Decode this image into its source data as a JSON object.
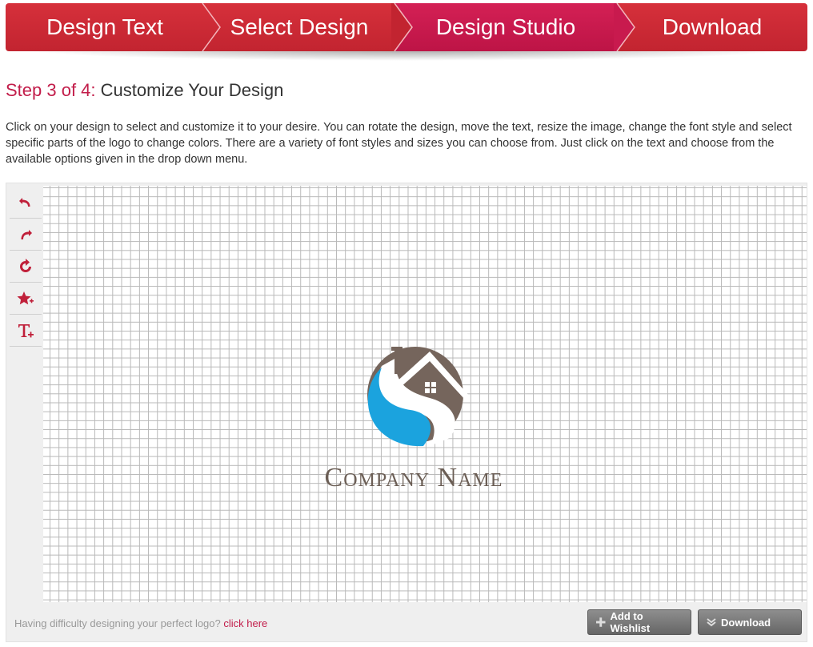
{
  "steps": [
    {
      "label": "Design Text"
    },
    {
      "label": "Select Design"
    },
    {
      "label": "Design Studio"
    },
    {
      "label": "Download"
    }
  ],
  "heading": {
    "step_prefix": "Step 3 of 4:",
    "title": "Customize Your Design"
  },
  "description": "Click on your design to select and customize it to your desire. You can rotate the design, move the text, resize the image, change the font style and select specific parts of the logo to change colors. There are a variety of font styles and sizes you can choose from. Just click on the text and choose from the available options given in the drop down menu.",
  "toolbar": {
    "icons": [
      "undo-icon",
      "redo-icon",
      "refresh-icon",
      "add-shape-icon",
      "add-text-icon"
    ]
  },
  "canvas": {
    "company_name": "Company Name"
  },
  "colors": {
    "primary_red": "#c22430",
    "active_step": "#c21d4a",
    "logo_blue": "#1ba3de",
    "logo_brown": "#75655c"
  },
  "footer": {
    "help_text": "Having difficulty designing your perfect logo?",
    "help_link": "click here",
    "wishlist_label": "Add to Wishlist",
    "download_label": "Download"
  }
}
